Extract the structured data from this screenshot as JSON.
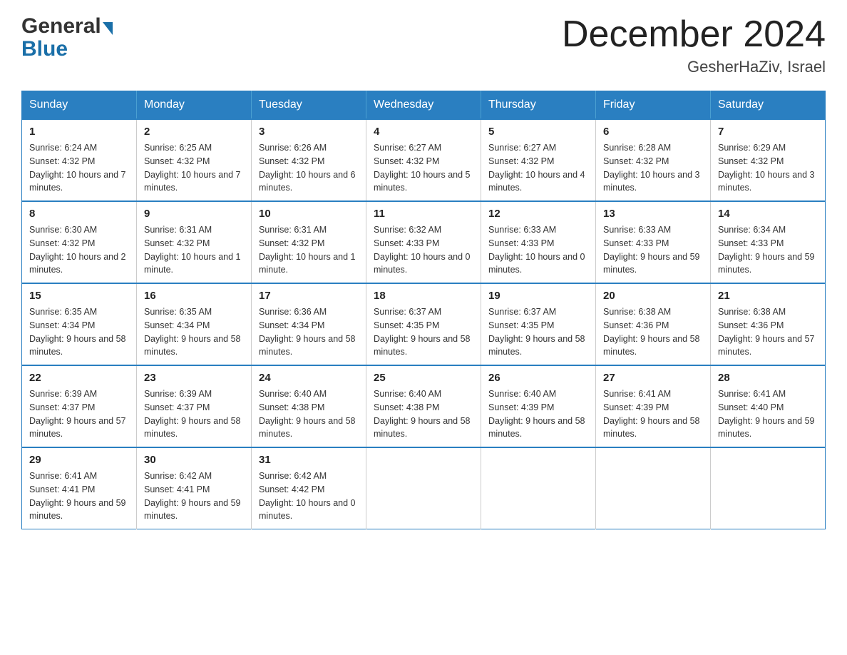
{
  "header": {
    "logo_general": "General",
    "logo_blue": "Blue",
    "month_title": "December 2024",
    "location": "GesherHaZiv, Israel"
  },
  "weekdays": [
    "Sunday",
    "Monday",
    "Tuesday",
    "Wednesday",
    "Thursday",
    "Friday",
    "Saturday"
  ],
  "weeks": [
    [
      {
        "day": "1",
        "sunrise": "6:24 AM",
        "sunset": "4:32 PM",
        "daylight": "10 hours and 7 minutes."
      },
      {
        "day": "2",
        "sunrise": "6:25 AM",
        "sunset": "4:32 PM",
        "daylight": "10 hours and 7 minutes."
      },
      {
        "day": "3",
        "sunrise": "6:26 AM",
        "sunset": "4:32 PM",
        "daylight": "10 hours and 6 minutes."
      },
      {
        "day": "4",
        "sunrise": "6:27 AM",
        "sunset": "4:32 PM",
        "daylight": "10 hours and 5 minutes."
      },
      {
        "day": "5",
        "sunrise": "6:27 AM",
        "sunset": "4:32 PM",
        "daylight": "10 hours and 4 minutes."
      },
      {
        "day": "6",
        "sunrise": "6:28 AM",
        "sunset": "4:32 PM",
        "daylight": "10 hours and 3 minutes."
      },
      {
        "day": "7",
        "sunrise": "6:29 AM",
        "sunset": "4:32 PM",
        "daylight": "10 hours and 3 minutes."
      }
    ],
    [
      {
        "day": "8",
        "sunrise": "6:30 AM",
        "sunset": "4:32 PM",
        "daylight": "10 hours and 2 minutes."
      },
      {
        "day": "9",
        "sunrise": "6:31 AM",
        "sunset": "4:32 PM",
        "daylight": "10 hours and 1 minute."
      },
      {
        "day": "10",
        "sunrise": "6:31 AM",
        "sunset": "4:32 PM",
        "daylight": "10 hours and 1 minute."
      },
      {
        "day": "11",
        "sunrise": "6:32 AM",
        "sunset": "4:33 PM",
        "daylight": "10 hours and 0 minutes."
      },
      {
        "day": "12",
        "sunrise": "6:33 AM",
        "sunset": "4:33 PM",
        "daylight": "10 hours and 0 minutes."
      },
      {
        "day": "13",
        "sunrise": "6:33 AM",
        "sunset": "4:33 PM",
        "daylight": "9 hours and 59 minutes."
      },
      {
        "day": "14",
        "sunrise": "6:34 AM",
        "sunset": "4:33 PM",
        "daylight": "9 hours and 59 minutes."
      }
    ],
    [
      {
        "day": "15",
        "sunrise": "6:35 AM",
        "sunset": "4:34 PM",
        "daylight": "9 hours and 58 minutes."
      },
      {
        "day": "16",
        "sunrise": "6:35 AM",
        "sunset": "4:34 PM",
        "daylight": "9 hours and 58 minutes."
      },
      {
        "day": "17",
        "sunrise": "6:36 AM",
        "sunset": "4:34 PM",
        "daylight": "9 hours and 58 minutes."
      },
      {
        "day": "18",
        "sunrise": "6:37 AM",
        "sunset": "4:35 PM",
        "daylight": "9 hours and 58 minutes."
      },
      {
        "day": "19",
        "sunrise": "6:37 AM",
        "sunset": "4:35 PM",
        "daylight": "9 hours and 58 minutes."
      },
      {
        "day": "20",
        "sunrise": "6:38 AM",
        "sunset": "4:36 PM",
        "daylight": "9 hours and 58 minutes."
      },
      {
        "day": "21",
        "sunrise": "6:38 AM",
        "sunset": "4:36 PM",
        "daylight": "9 hours and 57 minutes."
      }
    ],
    [
      {
        "day": "22",
        "sunrise": "6:39 AM",
        "sunset": "4:37 PM",
        "daylight": "9 hours and 57 minutes."
      },
      {
        "day": "23",
        "sunrise": "6:39 AM",
        "sunset": "4:37 PM",
        "daylight": "9 hours and 58 minutes."
      },
      {
        "day": "24",
        "sunrise": "6:40 AM",
        "sunset": "4:38 PM",
        "daylight": "9 hours and 58 minutes."
      },
      {
        "day": "25",
        "sunrise": "6:40 AM",
        "sunset": "4:38 PM",
        "daylight": "9 hours and 58 minutes."
      },
      {
        "day": "26",
        "sunrise": "6:40 AM",
        "sunset": "4:39 PM",
        "daylight": "9 hours and 58 minutes."
      },
      {
        "day": "27",
        "sunrise": "6:41 AM",
        "sunset": "4:39 PM",
        "daylight": "9 hours and 58 minutes."
      },
      {
        "day": "28",
        "sunrise": "6:41 AM",
        "sunset": "4:40 PM",
        "daylight": "9 hours and 59 minutes."
      }
    ],
    [
      {
        "day": "29",
        "sunrise": "6:41 AM",
        "sunset": "4:41 PM",
        "daylight": "9 hours and 59 minutes."
      },
      {
        "day": "30",
        "sunrise": "6:42 AM",
        "sunset": "4:41 PM",
        "daylight": "9 hours and 59 minutes."
      },
      {
        "day": "31",
        "sunrise": "6:42 AM",
        "sunset": "4:42 PM",
        "daylight": "10 hours and 0 minutes."
      },
      null,
      null,
      null,
      null
    ]
  ]
}
